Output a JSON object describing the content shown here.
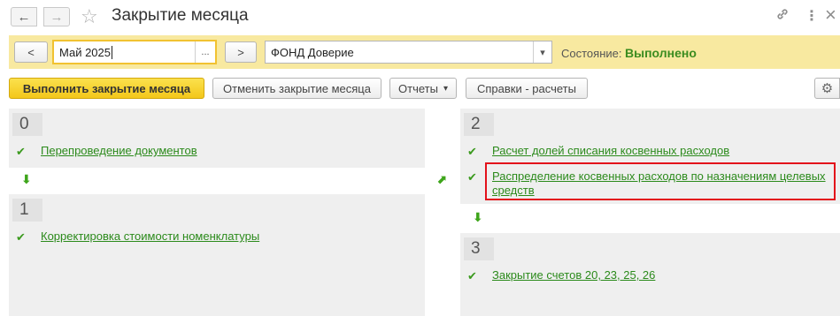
{
  "header": {
    "back_icon": "←",
    "forward_icon": "→",
    "favorite_icon": "☆",
    "title": "Закрытие месяца",
    "link_icon": "🔗",
    "more_icon": "⋮",
    "close_icon": "×"
  },
  "params": {
    "prev_label": "<",
    "period_value": "Май 2025",
    "period_pick_label": "...",
    "next_label": ">",
    "org_value": "ФОНД Доверие",
    "org_dropdown_icon": "▾",
    "state_label": "Состояние:",
    "state_value": "Выполнено",
    "state_color": "#3b8c1f",
    "accent_color": "#f8e9a0"
  },
  "toolbar": {
    "run_label": "Выполнить закрытие месяца",
    "cancel_label": "Отменить закрытие месяца",
    "reports_label": "Отчеты",
    "reports_dropdown_icon": "▾",
    "calc_label": "Справки - расчеты",
    "gear_icon": "⚙"
  },
  "stages": [
    {
      "number": "0",
      "tasks": [
        {
          "status": "done",
          "label": "Перепроведение документов"
        }
      ]
    },
    {
      "number": "1",
      "tasks": [
        {
          "status": "done",
          "label": "Корректировка стоимости номенклатуры"
        }
      ]
    },
    {
      "number": "2",
      "tasks": [
        {
          "status": "done",
          "label": "Расчет долей списания косвенных расходов"
        },
        {
          "status": "done",
          "label_line1": "Распределение косвенных расходов по назначениям целевых",
          "label_line2": "средств",
          "highlighted": true
        }
      ]
    },
    {
      "number": "3",
      "tasks": [
        {
          "status": "done",
          "label": "Закрытие счетов 20, 23, 25, 26"
        }
      ]
    }
  ],
  "glyphs": {
    "check": "✔",
    "arrow_down": "⬇",
    "arrow_diag": "⬈"
  }
}
